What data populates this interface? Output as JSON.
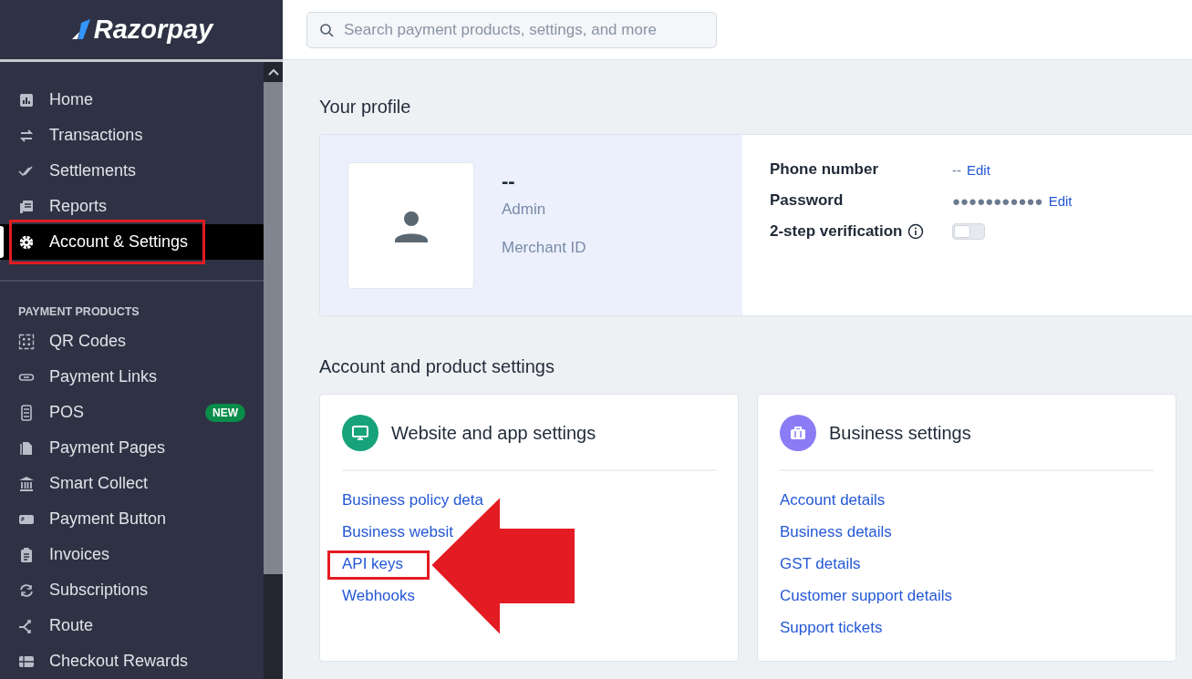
{
  "sidebar": {
    "logo": "Razorpay",
    "items": [
      {
        "label": "Home",
        "selected": false
      },
      {
        "label": "Transactions",
        "selected": false
      },
      {
        "label": "Settlements",
        "selected": false
      },
      {
        "label": "Reports",
        "selected": false
      },
      {
        "label": "Account & Settings",
        "selected": true
      }
    ],
    "section_title": "PAYMENT PRODUCTS",
    "products": [
      {
        "label": "QR Codes"
      },
      {
        "label": "Payment Links"
      },
      {
        "label": "POS",
        "badge": "NEW"
      },
      {
        "label": "Payment Pages"
      },
      {
        "label": "Smart Collect"
      },
      {
        "label": "Payment Button"
      },
      {
        "label": "Invoices"
      },
      {
        "label": "Subscriptions"
      },
      {
        "label": "Route"
      },
      {
        "label": "Checkout Rewards"
      }
    ]
  },
  "search": {
    "placeholder": "Search payment products, settings, and more"
  },
  "profile": {
    "heading": "Your profile",
    "name": "--",
    "role": "Admin",
    "merchant_label": "Merchant ID",
    "fields": [
      {
        "kind": "text",
        "label": "Phone number",
        "value": "--",
        "action": "Edit"
      },
      {
        "kind": "text",
        "label": "Password",
        "value": "●●●●●●●●●●●",
        "action": "Edit"
      },
      {
        "kind": "toggle",
        "label": "2-step verification",
        "on": false
      }
    ]
  },
  "settings": {
    "heading": "Account and product settings",
    "cards": [
      {
        "title": "Website and app settings",
        "color": "#16a37a",
        "links": [
          "Business policy deta",
          "Business websit",
          "API keys",
          "Webhooks"
        ]
      },
      {
        "title": "Business settings",
        "color": "#8b7cf6",
        "links": [
          "Account details",
          "Business details",
          "GST details",
          "Customer support details",
          "Support tickets"
        ]
      }
    ]
  }
}
